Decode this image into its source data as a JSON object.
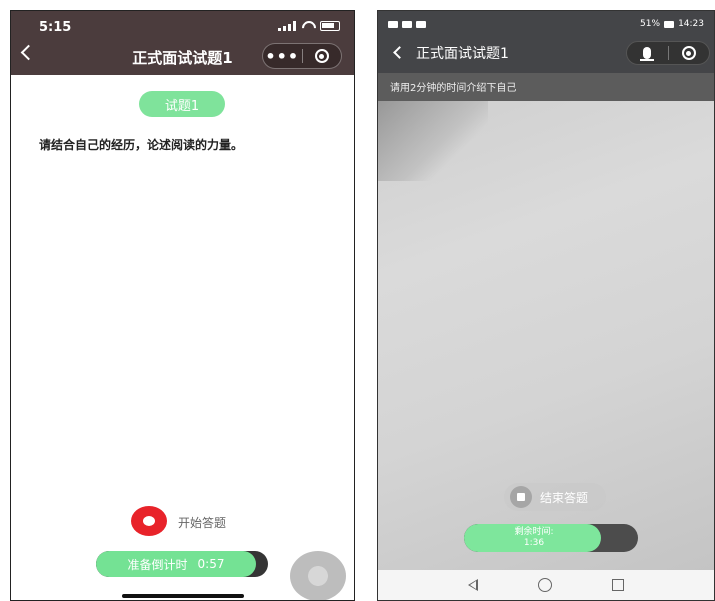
{
  "left": {
    "status": {
      "time": "5:15"
    },
    "nav": {
      "title": "正式面试试题1",
      "more_label": "•••"
    },
    "question": {
      "badge": "试题1",
      "text": "请结合自己的经历，论述阅读的力量。"
    },
    "controls": {
      "start_label": "开始答题",
      "countdown_label": "准备倒计时",
      "countdown_value": "0:57",
      "countdown_progress": 0.93
    }
  },
  "right": {
    "status": {
      "battery": "51%",
      "time": "14:23"
    },
    "nav": {
      "title": "正式面试试题1"
    },
    "instruction": "请用2分钟的时间介绍下自己",
    "controls": {
      "stop_label": "结束答题",
      "remaining_label": "剩余时间:",
      "remaining_value": "1:36",
      "remaining_progress": 0.79
    }
  },
  "colors": {
    "accent_green": "#7fe39b",
    "record_red": "#e8232a",
    "header_left": "#4b3c3d",
    "header_right": "#444548"
  }
}
